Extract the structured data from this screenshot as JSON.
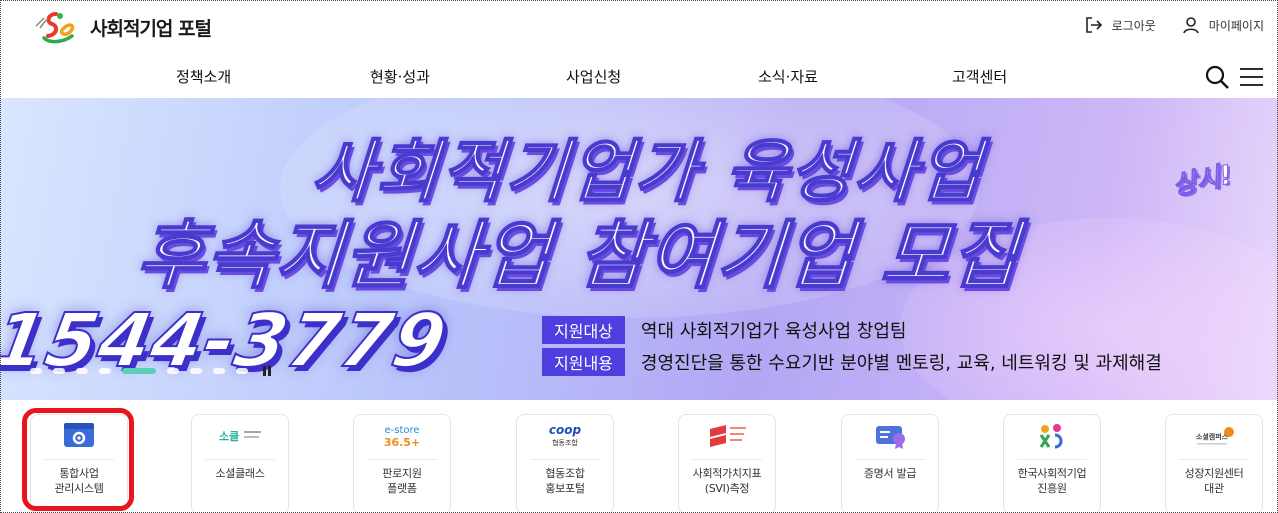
{
  "header": {
    "logo_text": "사회적기업 포털",
    "logout_label": "로그아웃",
    "mypage_label": "마이페이지"
  },
  "nav": {
    "items": [
      "정책소개",
      "현황·성과",
      "사업신청",
      "소식·자료",
      "고객센터"
    ]
  },
  "banner": {
    "headline_1": "사회적기업가 육성사업",
    "headline_2": "후속지원사업 참여기업 모집",
    "badge": "상시!",
    "phone": "1544-3779",
    "rows": [
      {
        "tag": "지원대상",
        "desc": "역대 사회적기업가 육성사업 창업팀"
      },
      {
        "tag": "지원내용",
        "desc": "경영진단을 통한 수요기반 분야별 멘토링, 교육, 네트워킹 및 과제해결"
      }
    ],
    "slides_count": 9,
    "active_slide": 5
  },
  "quick_links": [
    {
      "icon": "gear-window-icon",
      "icon_text": "",
      "label": "통합사업\n관리시스템"
    },
    {
      "icon": "social-class-logo-icon",
      "icon_text": "소클",
      "label": "소셜클래스"
    },
    {
      "icon": "estore-logo-icon",
      "icon_text": "e-store 36.5+",
      "label": "판로지원\n플랫폼"
    },
    {
      "icon": "coop-logo-icon",
      "icon_text": "coop 협동조합",
      "label": "협동조합\n홍보포털"
    },
    {
      "icon": "svi-logo-icon",
      "icon_text": "",
      "label": "사회적가치지표\n(SVI)측정"
    },
    {
      "icon": "certificate-icon",
      "icon_text": "",
      "label": "증명서 발급"
    },
    {
      "icon": "ksea-logo-icon",
      "icon_text": "",
      "label": "한국사회적기업\n진흥원"
    },
    {
      "icon": "social-campus-logo-icon",
      "icon_text": "소셜캠퍼스",
      "label": "성장지원센터\n대관"
    }
  ],
  "colors": {
    "accent": "#4f3ee0",
    "highlight": "#e8161c",
    "indicator_active": "#5ad0b8"
  }
}
